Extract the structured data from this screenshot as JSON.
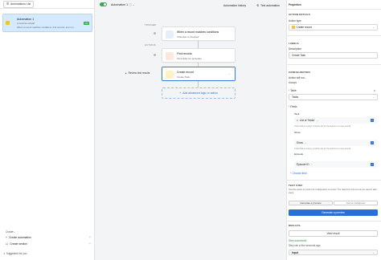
{
  "left": {
    "list_button": "Automations List",
    "automation": {
      "title": "Automation 1",
      "subtitle": "A new-line rebuild",
      "description": "When a record matches conditions, find records, and 1 m...",
      "status": "ON"
    },
    "create_label": "Create...",
    "create_automation": "Create automation",
    "create_section": "Create section",
    "suggested": "Suggested for you"
  },
  "toolbar": {
    "automation_name": "Automation 1",
    "history": "Automation history",
    "test": "Test automation"
  },
  "canvas": {
    "trigger_label": "TRIGGER",
    "actions_label": "ACTIONS",
    "trigger": {
      "title": "When a record matches conditions",
      "subtitle": "If Review is checked"
    },
    "action1": {
      "title": "Find records",
      "subtitle": "Find tasks for episodes"
    },
    "action2": {
      "title": "Create record",
      "subtitle": "Create Task"
    },
    "review": "Review test results",
    "add": "Add advanced logic or action"
  },
  "properties": {
    "title": "Properties",
    "action_details": "ACTION DETAILS",
    "action_type_label": "Action type",
    "action_type": "Create record",
    "labels": "LABELS",
    "description_label": "Description",
    "description": "Create Task",
    "configuration": "CONFIGURATION",
    "action_run_label": "Action will run...",
    "action_run": "Always",
    "table_label": "Table",
    "table": "Tasks",
    "fields_label": "Fields",
    "field1_label": "Task",
    "field1_value": "List of 'Tasks'",
    "field1_hint": "If the field is empty, it will be set by the action in a new record",
    "field2_label": "Show",
    "field2_value": "Show",
    "field3_label": "Episode",
    "field3_value": "Episode ID",
    "choose_field": "Choose field",
    "test_step": "TEST STEP",
    "test_desc": "Test this action to confirm its configuration is correct. The data from this test can be used in later steps.",
    "tab1": "Generate a preview",
    "tab2": "Not be configured",
    "generate": "Generate a preview",
    "results": "RESULTS",
    "view_result": "View result",
    "success": "Step successful",
    "ran_ago": "Step ran a few seconds ago",
    "input": "Input"
  }
}
